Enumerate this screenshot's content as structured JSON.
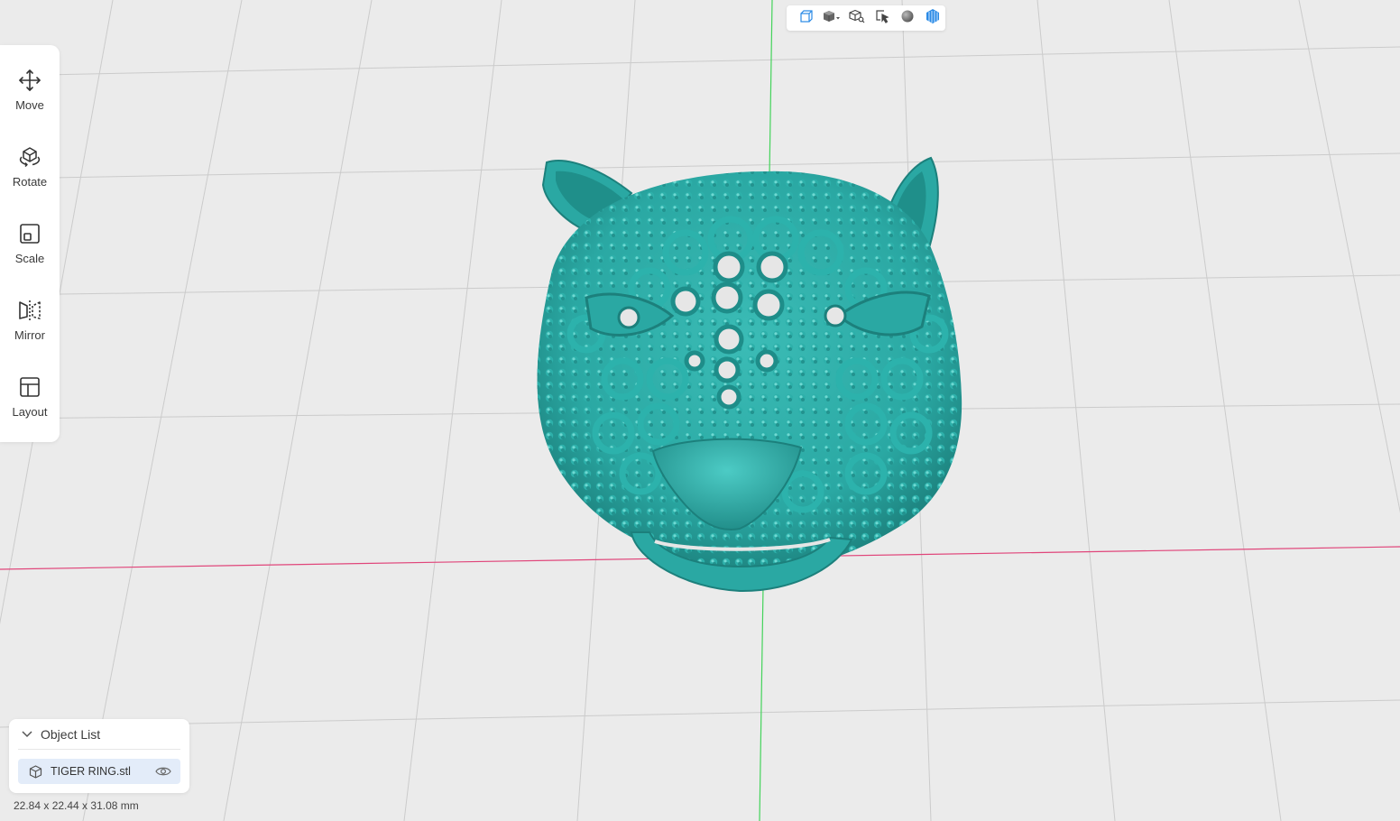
{
  "tools": [
    {
      "id": "move",
      "label": "Move",
      "icon": "move-arrows-icon"
    },
    {
      "id": "rotate",
      "label": "Rotate",
      "icon": "rotate-cube-icon"
    },
    {
      "id": "scale",
      "label": "Scale",
      "icon": "scale-square-icon"
    },
    {
      "id": "mirror",
      "label": "Mirror",
      "icon": "mirror-icon"
    },
    {
      "id": "layout",
      "label": "Layout",
      "icon": "layout-icon"
    }
  ],
  "view_toolbar": [
    {
      "id": "perspective",
      "icon": "perspective-view-icon"
    },
    {
      "id": "view-cube",
      "icon": "view-cube-dropdown-icon"
    },
    {
      "id": "zoom-fit",
      "icon": "zoom-fit-cube-icon"
    },
    {
      "id": "select",
      "icon": "select-cursor-icon"
    },
    {
      "id": "shading",
      "icon": "solid-shading-sphere-icon"
    },
    {
      "id": "render",
      "icon": "model-render-icon"
    }
  ],
  "object_list": {
    "title": "Object List",
    "items": [
      {
        "name": "TIGER RING.stl",
        "icon": "model-cube-icon",
        "visible": true
      }
    ]
  },
  "dimensions": "22.84 x 22.44 x 31.08 mm",
  "colors": {
    "model": "#2aa8a3",
    "model_shadow": "#1c807c",
    "model_highlight": "#5fd1cb",
    "x_axis": "#e0457a",
    "y_axis": "#43d35a",
    "grid": "#c9c9c9",
    "accent": "#2a8ae5"
  }
}
